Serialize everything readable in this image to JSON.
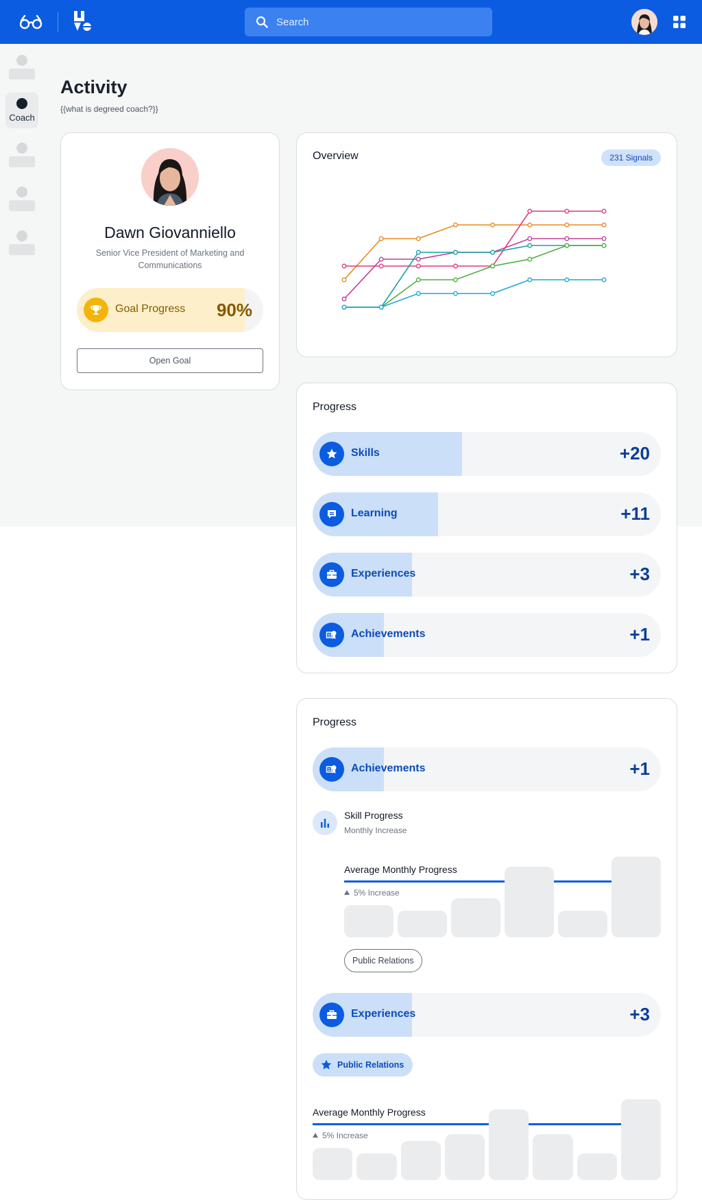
{
  "header": {
    "search_placeholder": "Search",
    "brand_color": "#0b5ce0"
  },
  "sidebar": {
    "active_label": "Coach"
  },
  "page": {
    "title": "Activity",
    "subtitle": "{{what is degreed coach?}}"
  },
  "profile": {
    "name": "Dawn Giovanniello",
    "role": "Senior Vice President of Marketing and Communications",
    "goal_label": "Goal Progress",
    "goal_value": "90%",
    "goal_fraction": 0.9,
    "open_goal_label": "Open Goal"
  },
  "overview": {
    "title": "Overview",
    "signals_badge": "231 Signals",
    "chart_data": {
      "type": "line",
      "x": [
        1,
        2,
        3,
        4,
        5,
        6,
        7,
        8
      ],
      "ylim": [
        0,
        10
      ],
      "grid": false,
      "legend": "none",
      "series": [
        {
          "color": "#e8891e",
          "values": [
            3.3,
            6.3,
            6.3,
            7.3,
            7.3,
            7.3,
            7.3,
            7.3
          ]
        },
        {
          "color": "#e2367c",
          "values": [
            4.3,
            4.3,
            4.3,
            4.3,
            4.3,
            8.3,
            8.3,
            8.3
          ]
        },
        {
          "color": "#c23e9a",
          "values": [
            1.9,
            4.8,
            4.8,
            5.3,
            5.3,
            6.3,
            6.3,
            6.3
          ]
        },
        {
          "color": "#14a0a8",
          "values": [
            1.3,
            1.3,
            5.3,
            5.3,
            5.3,
            5.8,
            5.8,
            5.8
          ]
        },
        {
          "color": "#4cae3a",
          "values": [
            1.3,
            1.3,
            3.3,
            3.3,
            4.3,
            4.8,
            5.8,
            5.8
          ]
        },
        {
          "color": "#1aa7d6",
          "values": [
            1.3,
            1.3,
            2.3,
            2.3,
            2.3,
            3.3,
            3.3,
            3.3
          ]
        }
      ]
    }
  },
  "progress_card": {
    "title": "Progress",
    "rows": [
      {
        "label": "Skills",
        "value": "+20",
        "fill": 0.43,
        "icon": "star-icon"
      },
      {
        "label": "Learning",
        "value": "+11",
        "fill": 0.36,
        "icon": "chat-icon"
      },
      {
        "label": "Experiences",
        "value": "+3",
        "fill": 0.285,
        "icon": "briefcase-icon"
      },
      {
        "label": "Achievements",
        "value": "+1",
        "fill": 0.205,
        "icon": "award-icon"
      }
    ]
  },
  "progress_detail": {
    "title": "Progress",
    "achievements": {
      "label": "Achievements",
      "value": "+1",
      "fill": 0.205
    },
    "skill_progress": {
      "title": "Skill Progress",
      "subtitle": "Monthly Increase"
    },
    "amp1": {
      "title": "Average Monthly Progress",
      "increase": "5% Increase",
      "bars": [
        0.4,
        0.33,
        0.48,
        0.87,
        0.33,
        1.0
      ]
    },
    "skill_tag": "Public Relations",
    "experiences": {
      "label": "Experiences",
      "value": "+3",
      "fill": 0.285
    },
    "experience_tag": "Public Relations",
    "amp2": {
      "title": "Average Monthly Progress",
      "increase": "5% Increase",
      "bars": [
        0.4,
        0.33,
        0.48,
        0.57,
        0.87,
        0.57,
        0.33,
        1.0
      ]
    }
  }
}
